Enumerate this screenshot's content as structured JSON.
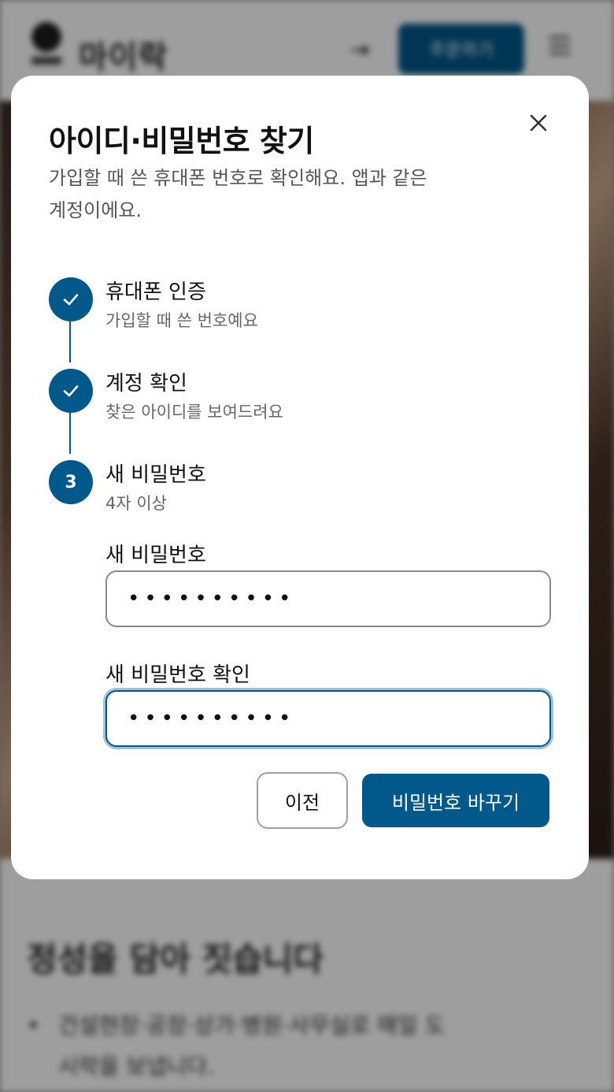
{
  "background": {
    "brand_name": "마이락",
    "order_button": "주문하기",
    "headline": "정성을 담아 짓습니다",
    "bullet": "건설현장·공장·상가·병원·사무실로 매일 도시락을 보냅니다."
  },
  "modal": {
    "title": "아이디·비밀번호 찾기",
    "subtitle": "가입할 때 쓴 휴대폰 번호로 확인해요. 앱과 같은 계정이에요.",
    "steps": [
      {
        "title": "휴대폰 인증",
        "desc": "가입할 때 쓴 번호예요",
        "status": "done",
        "icon": "check-icon"
      },
      {
        "title": "계정 확인",
        "desc": "찾은 아이디를 보여드려요",
        "status": "done",
        "icon": "check-icon"
      },
      {
        "title": "새 비밀번호",
        "desc": "4자 이상",
        "status": "current",
        "number": "3"
      }
    ],
    "new_password": {
      "label": "새 비밀번호",
      "value": "••••••••••"
    },
    "confirm_password": {
      "label": "새 비밀번호 확인",
      "value": "••••••••••"
    },
    "prev_button": "이전",
    "submit_button": "비밀번호 바꾸기"
  },
  "colors": {
    "accent": "#01588a",
    "focus_ring": "#9dc3d8",
    "overlay": "rgba(0,0,0,0.38)"
  }
}
